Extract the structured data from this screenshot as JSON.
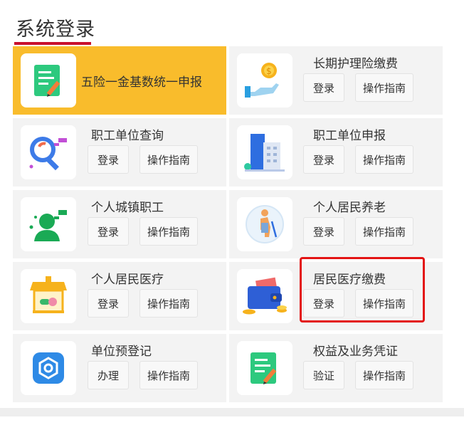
{
  "section_title": "系统登录",
  "colors": {
    "accent_red": "#c8102e",
    "highlight_yellow": "#f9bc2c",
    "outline_red": "#e31414"
  },
  "cards": [
    {
      "name": "五险一金基数统一申报",
      "icon": "document-edit-icon",
      "buttons": []
    },
    {
      "name": "长期护理险缴费",
      "icon": "coin-hand-icon",
      "buttons": [
        "登录",
        "操作指南"
      ]
    },
    {
      "name": "职工单位查询",
      "icon": "magnifier-icon",
      "buttons": [
        "登录",
        "操作指南"
      ]
    },
    {
      "name": "职工单位申报",
      "icon": "building-icon",
      "buttons": [
        "登录",
        "操作指南"
      ]
    },
    {
      "name": "个人城镇职工",
      "icon": "person-chat-icon",
      "buttons": [
        "登录",
        "操作指南"
      ]
    },
    {
      "name": "个人居民养老",
      "icon": "elderly-person-icon",
      "buttons": [
        "登录",
        "操作指南"
      ]
    },
    {
      "name": "个人居民医疗",
      "icon": "pharmacy-icon",
      "buttons": [
        "登录",
        "操作指南"
      ]
    },
    {
      "name": "居民医疗缴费",
      "icon": "wallet-icon",
      "buttons": [
        "登录",
        "操作指南"
      ]
    },
    {
      "name": "单位预登记",
      "icon": "gear-badge-icon",
      "buttons": [
        "办理",
        "操作指南"
      ]
    },
    {
      "name": "权益及业务凭证",
      "icon": "document-edit-icon",
      "buttons": [
        "验证",
        "操作指南"
      ]
    }
  ]
}
